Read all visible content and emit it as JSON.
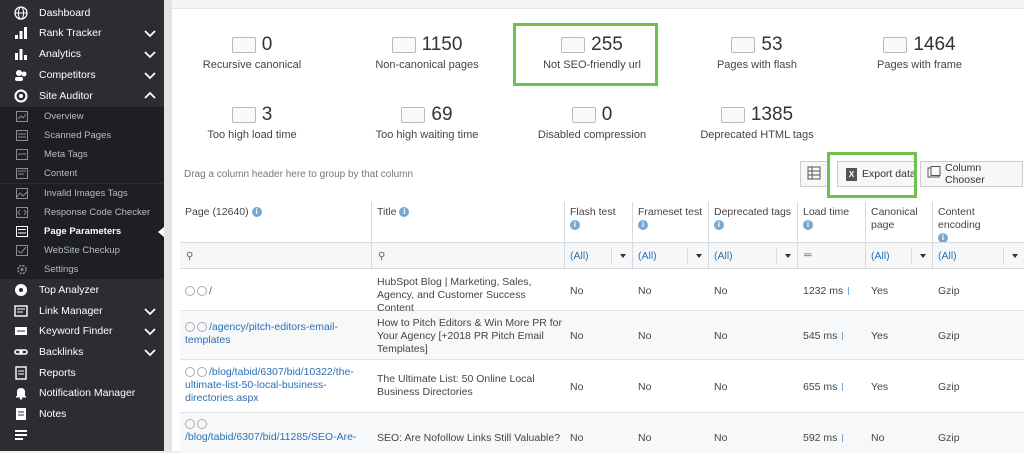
{
  "sidebar": {
    "items": [
      {
        "label": "Dashboard",
        "icon": "globe-icon",
        "chevron": ""
      },
      {
        "label": "Rank Tracker",
        "icon": "rank-icon",
        "chevron": "down"
      },
      {
        "label": "Analytics",
        "icon": "analytics-icon",
        "chevron": "down"
      },
      {
        "label": "Competitors",
        "icon": "competitors-icon",
        "chevron": "down"
      },
      {
        "label": "Site Auditor",
        "icon": "auditor-icon",
        "chevron": "up"
      }
    ],
    "subitems": [
      {
        "label": "Overview"
      },
      {
        "label": "Scanned Pages"
      },
      {
        "label": "Meta Tags"
      },
      {
        "label": "Content"
      },
      {
        "label": "Invalid Images Tags"
      },
      {
        "label": "Response Code Checker"
      },
      {
        "label": "Page Parameters",
        "active": true
      },
      {
        "label": "WebSite Checkup"
      },
      {
        "label": "Settings"
      }
    ],
    "items2": [
      {
        "label": "Top Analyzer",
        "icon": "top-analyzer-icon",
        "chevron": ""
      },
      {
        "label": "Link Manager",
        "icon": "link-manager-icon",
        "chevron": "down"
      },
      {
        "label": "Keyword Finder",
        "icon": "keyword-icon",
        "chevron": "down"
      },
      {
        "label": "Backlinks",
        "icon": "backlinks-icon",
        "chevron": "down"
      },
      {
        "label": "Reports",
        "icon": "reports-icon",
        "chevron": ""
      },
      {
        "label": "Notification Manager",
        "icon": "bell-icon",
        "chevron": ""
      },
      {
        "label": "Notes",
        "icon": "notes-icon",
        "chevron": ""
      }
    ]
  },
  "stats": [
    {
      "value": "0",
      "label": "Recursive canonical"
    },
    {
      "value": "1150",
      "label": "Non-canonical pages"
    },
    {
      "value": "255",
      "label": "Not SEO-friendly url"
    },
    {
      "value": "53",
      "label": "Pages with flash"
    },
    {
      "value": "1464",
      "label": "Pages with frame"
    },
    {
      "value": "3",
      "label": "Too high load time"
    },
    {
      "value": "69",
      "label": "Too high waiting time"
    },
    {
      "value": "0",
      "label": "Disabled compression"
    },
    {
      "value": "1385",
      "label": "Deprecated HTML tags"
    }
  ],
  "toolbar": {
    "drag_hint": "Drag a column header here to group by that column",
    "export_label": "Export data",
    "column_chooser_label": "Column Chooser"
  },
  "grid": {
    "headers": [
      "Page (12640)",
      "Title",
      "Flash test",
      "Frameset test",
      "Deprecated tags",
      "Load time",
      "Canonical page",
      "Content encoding"
    ],
    "filter_all": "(All)",
    "rows": [
      {
        "page": "/",
        "title": "HubSpot Blog | Marketing, Sales, Agency, and Customer Success Content",
        "flash": "No",
        "frameset": "No",
        "deprecated": "No",
        "load": "1232 ms",
        "canonical": "Yes",
        "encoding": "Gzip"
      },
      {
        "page": "/agency/pitch-editors-email-templates",
        "title": "How to Pitch Editors & Win More PR for Your Agency [+2018 PR Pitch Email Templates]",
        "flash": "No",
        "frameset": "No",
        "deprecated": "No",
        "load": "545 ms",
        "canonical": "Yes",
        "encoding": "Gzip"
      },
      {
        "page": "/blog/tabid/6307/bid/10322/the-ultimate-list-50-local-business-directories.aspx",
        "title": "The Ultimate List: 50 Online Local Business Directories",
        "flash": "No",
        "frameset": "No",
        "deprecated": "No",
        "load": "655 ms",
        "canonical": "Yes",
        "encoding": "Gzip"
      },
      {
        "page": "/blog/tabid/6307/bid/11285/SEO-Are-",
        "title": "SEO: Are Nofollow Links Still Valuable?",
        "flash": "No",
        "frameset": "No",
        "deprecated": "No",
        "load": "592 ms",
        "canonical": "No",
        "encoding": "Gzip"
      }
    ]
  },
  "colors": {
    "highlight": "#6cc24a",
    "link": "#2a6fb5",
    "sidebar": "#2b2d30"
  }
}
